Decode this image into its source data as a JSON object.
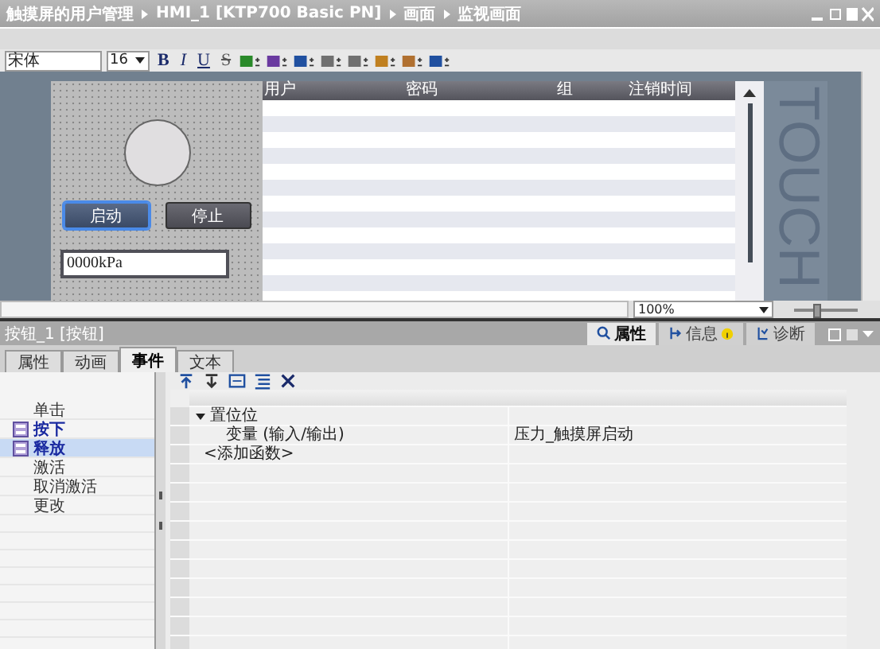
{
  "breadcrumb": [
    "触摸屏的用户管理",
    "HMI_1 [KTP700 Basic PN]",
    "画面",
    "监视画面"
  ],
  "toolbar": {
    "font": "宋体",
    "size": "16",
    "text_buttons": [
      {
        "label": "B",
        "kind": "bold"
      },
      {
        "label": "I",
        "kind": "italic"
      },
      {
        "label": "U",
        "kind": "underline"
      },
      {
        "label": "S",
        "kind": "strike"
      }
    ]
  },
  "screen": {
    "buttons": [
      {
        "label": "启动",
        "selected": true
      },
      {
        "label": "停止",
        "selected": false
      }
    ],
    "io_field": "0000kPa"
  },
  "user_table": {
    "columns": [
      "用户",
      "密码",
      "组",
      "注销时间"
    ]
  },
  "touch_label": "TOUCH",
  "zoom": {
    "value": "100%",
    "level": 0.35
  },
  "inspector": {
    "title": "按钮_1 [按钮]",
    "views": [
      {
        "label": "属性",
        "selected": true,
        "kind": "properties"
      },
      {
        "label": "信息",
        "selected": false,
        "kind": "info"
      },
      {
        "label": "诊断",
        "selected": false,
        "kind": "diagnostics"
      }
    ],
    "tabs": [
      {
        "label": "属性",
        "selected": false
      },
      {
        "label": "动画",
        "selected": false
      },
      {
        "label": "事件",
        "selected": true
      },
      {
        "label": "文本",
        "selected": false
      }
    ],
    "events": [
      {
        "label": "单击",
        "configured": false,
        "selected": false
      },
      {
        "label": "按下",
        "configured": true,
        "selected": false
      },
      {
        "label": "释放",
        "configured": true,
        "selected": true
      },
      {
        "label": "激活",
        "configured": false,
        "selected": false
      },
      {
        "label": "取消激活",
        "configured": false,
        "selected": false
      },
      {
        "label": "更改",
        "configured": false,
        "selected": false
      }
    ],
    "functions": [
      {
        "name": "置位位",
        "expanded": true,
        "params": [
          {
            "name": "变量 (输入/输出)",
            "value": "压力_触摸屏启动"
          }
        ]
      }
    ],
    "add_function": "<添加函数>"
  }
}
